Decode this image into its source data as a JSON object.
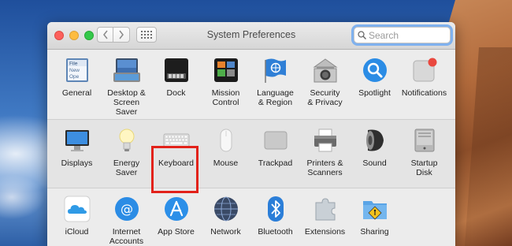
{
  "window": {
    "title": "System Preferences",
    "search_placeholder": "Search"
  },
  "sections": [
    {
      "items": [
        {
          "label": "General",
          "icon": "general-icon"
        },
        {
          "label": "Desktop &\nScreen Saver",
          "icon": "desktop-icon"
        },
        {
          "label": "Dock",
          "icon": "dock-icon"
        },
        {
          "label": "Mission\nControl",
          "icon": "mission-control-icon"
        },
        {
          "label": "Language\n& Region",
          "icon": "language-region-icon"
        },
        {
          "label": "Security\n& Privacy",
          "icon": "security-icon"
        },
        {
          "label": "Spotlight",
          "icon": "spotlight-icon"
        },
        {
          "label": "Notifications",
          "icon": "notifications-icon"
        }
      ]
    },
    {
      "items": [
        {
          "label": "Displays",
          "icon": "displays-icon"
        },
        {
          "label": "Energy\nSaver",
          "icon": "energy-saver-icon"
        },
        {
          "label": "Keyboard",
          "icon": "keyboard-icon"
        },
        {
          "label": "Mouse",
          "icon": "mouse-icon"
        },
        {
          "label": "Trackpad",
          "icon": "trackpad-icon"
        },
        {
          "label": "Printers &\nScanners",
          "icon": "printer-icon"
        },
        {
          "label": "Sound",
          "icon": "sound-icon"
        },
        {
          "label": "Startup\nDisk",
          "icon": "startup-disk-icon"
        }
      ]
    },
    {
      "items": [
        {
          "label": "iCloud",
          "icon": "icloud-icon"
        },
        {
          "label": "Internet\nAccounts",
          "icon": "internet-accounts-icon"
        },
        {
          "label": "App Store",
          "icon": "app-store-icon"
        },
        {
          "label": "Network",
          "icon": "network-icon"
        },
        {
          "label": "Bluetooth",
          "icon": "bluetooth-icon"
        },
        {
          "label": "Extensions",
          "icon": "extensions-icon"
        },
        {
          "label": "Sharing",
          "icon": "sharing-icon"
        }
      ]
    }
  ],
  "general_icon_text": [
    "File",
    "New",
    "Ope"
  ],
  "highlighted_item": "Keyboard",
  "colors": {
    "highlight": "#e2221a",
    "search_focus": "#7fb1ee",
    "notification_badge": "#e9483f"
  }
}
